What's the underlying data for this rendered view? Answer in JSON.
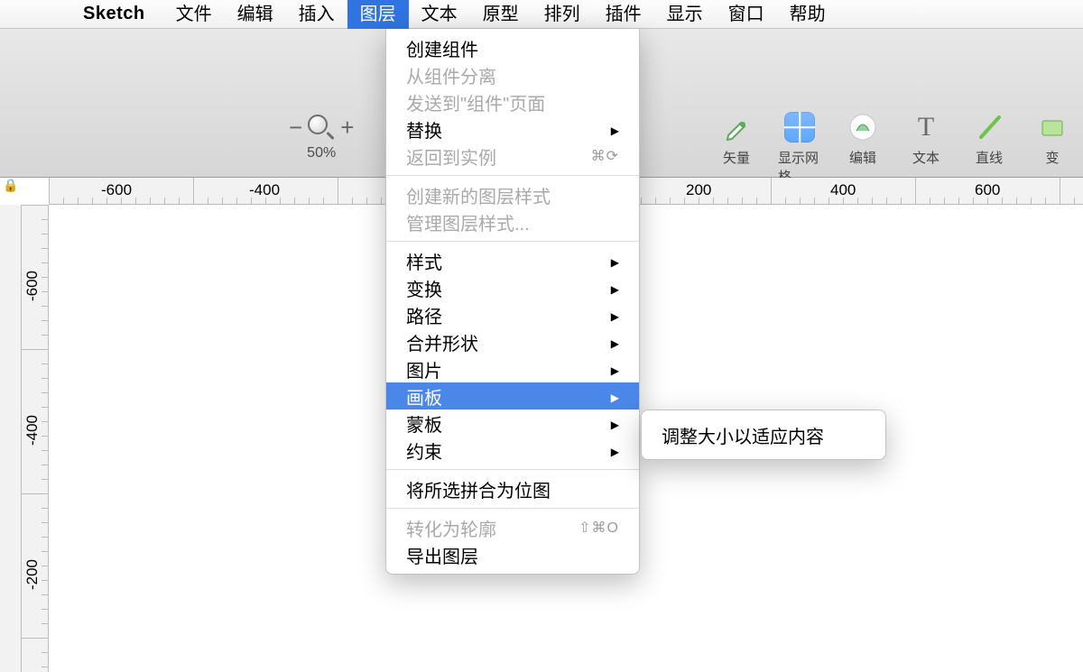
{
  "menubar": {
    "app_name": "Sketch",
    "items": [
      {
        "label": "文件"
      },
      {
        "label": "编辑"
      },
      {
        "label": "插入"
      },
      {
        "label": "图层",
        "selected": true
      },
      {
        "label": "文本"
      },
      {
        "label": "原型"
      },
      {
        "label": "排列"
      },
      {
        "label": "插件"
      },
      {
        "label": "显示"
      },
      {
        "label": "窗口"
      },
      {
        "label": "帮助"
      }
    ]
  },
  "toolbar": {
    "zoom": {
      "minus": "−",
      "plus": "+",
      "percent": "50%"
    },
    "tools": [
      {
        "name": "vector",
        "label": "矢量"
      },
      {
        "name": "grid",
        "label": "显示网格"
      },
      {
        "name": "edit",
        "label": "编辑"
      },
      {
        "name": "text",
        "label": "文本"
      },
      {
        "name": "line",
        "label": "直线"
      },
      {
        "name": "transform",
        "label": "变"
      }
    ]
  },
  "ruler": {
    "h_labels": [
      "-600",
      "-400",
      "200",
      "400",
      "600"
    ],
    "v_labels": [
      "-600",
      "-400",
      "-200"
    ]
  },
  "dropdown": {
    "groups": [
      [
        {
          "label": "创建组件",
          "disabled": false
        },
        {
          "label": "从组件分离",
          "disabled": true
        },
        {
          "label": "发送到\"组件\"页面",
          "disabled": true
        },
        {
          "label": "替换",
          "arrow": true
        },
        {
          "label": "返回到实例",
          "disabled": true,
          "shortcut": "⌘⟳"
        }
      ],
      [
        {
          "label": "创建新的图层样式",
          "disabled": true
        },
        {
          "label": "管理图层样式...",
          "disabled": true
        }
      ],
      [
        {
          "label": "样式",
          "arrow": true
        },
        {
          "label": "变换",
          "arrow": true
        },
        {
          "label": "路径",
          "arrow": true
        },
        {
          "label": "合并形状",
          "arrow": true
        },
        {
          "label": "图片",
          "arrow": true
        },
        {
          "label": "画板",
          "arrow": true,
          "selected": true
        },
        {
          "label": "蒙板",
          "arrow": true
        },
        {
          "label": "约束",
          "arrow": true
        }
      ],
      [
        {
          "label": "将所选拼合为位图"
        }
      ],
      [
        {
          "label": "转化为轮廓",
          "disabled": true,
          "shortcut": "⇧⌘O"
        },
        {
          "label": "导出图层"
        }
      ]
    ]
  },
  "submenu": {
    "items": [
      {
        "label": "调整大小以适应内容"
      }
    ]
  }
}
